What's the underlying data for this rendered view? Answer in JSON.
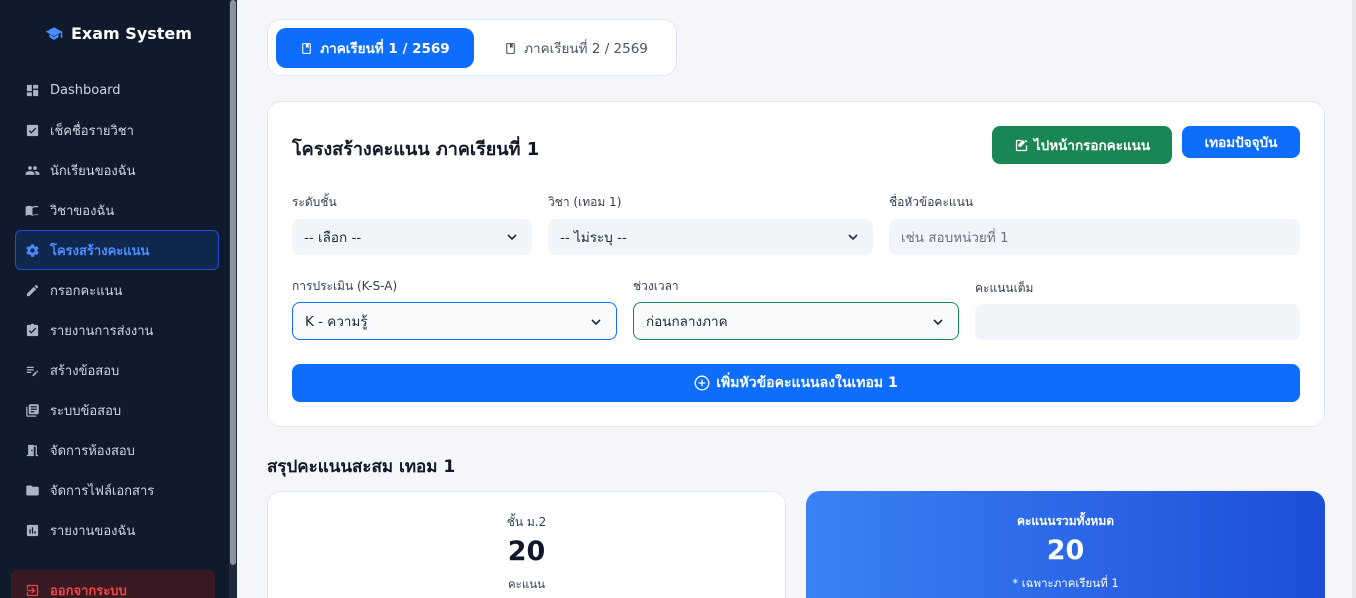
{
  "sidebar": {
    "brand": "Exam System",
    "items": [
      {
        "label": "Dashboard",
        "icon": "dashboard-icon"
      },
      {
        "label": "เช็คชื่อรายวิชา",
        "icon": "checklist-icon"
      },
      {
        "label": "นักเรียนของฉัน",
        "icon": "users-icon"
      },
      {
        "label": "วิชาของฉัน",
        "icon": "book-icon"
      },
      {
        "label": "โครงสร้างคะแนน",
        "icon": "gear-icon",
        "active": true
      },
      {
        "label": "กรอกคะแนน",
        "icon": "pencil-icon"
      },
      {
        "label": "รายงานการส่งงาน",
        "icon": "clipboard-check-icon"
      },
      {
        "label": "สร้างข้อสอบ",
        "icon": "edit-note-icon"
      },
      {
        "label": "ระบบข้อสอบ",
        "icon": "library-icon"
      },
      {
        "label": "จัดการห้องสอบ",
        "icon": "door-icon"
      },
      {
        "label": "จัดการไฟล์เอกสาร",
        "icon": "folder-icon"
      },
      {
        "label": "รายงานของฉัน",
        "icon": "report-icon"
      }
    ],
    "logout": "ออกจากระบบ"
  },
  "tabs": {
    "term1": "ภาคเรียนที่ 1 / 2569",
    "term2": "ภาคเรียนที่ 2 / 2569"
  },
  "card": {
    "title": "โครงสร้างคะแนน ภาคเรียนที่ 1",
    "goto_button": "ไปหน้ากรอกคะแนน",
    "current_term_button": "เทอมปัจจุบัน",
    "level": {
      "label": "ระดับชั้น",
      "value": "-- เลือก --"
    },
    "subject": {
      "label": "วิชา (เทอม 1)",
      "value": "-- ไม่ระบุ --"
    },
    "score_title": {
      "label": "ชื่อหัวข้อคะแนน",
      "placeholder": "เช่น สอบหน่วยที่ 1"
    },
    "assessment": {
      "label": "การประเมิน (K-S-A)",
      "value": "K - ความรู้"
    },
    "period": {
      "label": "ช่วงเวลา",
      "value": "ก่อนกลางภาค"
    },
    "full_score": {
      "label": "คะแนนเต็ม",
      "value": ""
    },
    "add_button": "เพิ่มหัวข้อคะแนนลงในเทอม 1"
  },
  "summary": {
    "title": "สรุปคะแนนสะสม เทอม 1",
    "class_card": {
      "label": "ชั้น ม.2",
      "value": "20",
      "unit": "คะแนน"
    },
    "total_card": {
      "label": "คะแนนรวมทั้งหมด",
      "value": "20",
      "note": "* เฉพาะภาคเรียนที่ 1"
    }
  },
  "colors": {
    "primary": "#0d6efd",
    "success": "#198754",
    "sidebar_bg": "#0f1b2d",
    "danger": "#ef4444"
  }
}
